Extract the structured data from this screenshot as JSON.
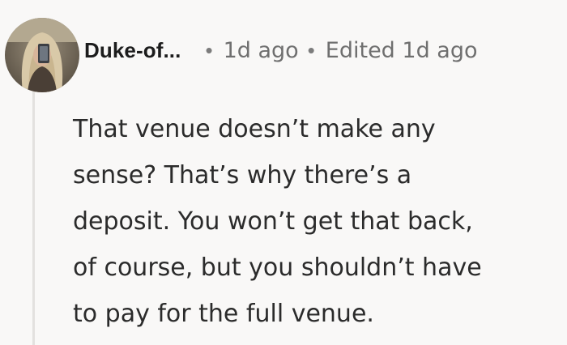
{
  "comment": {
    "author": "Duke-of...",
    "separator": "•",
    "timestamp": "1d ago",
    "edited_label": "Edited 1d ago",
    "body_lines": [
      "That venue doesn’t make any",
      "sense? That’s why there’s a",
      "deposit. You won’t get that back,",
      "of course, but you shouldn’t have",
      "to pay for the full venue."
    ]
  },
  "colors": {
    "background": "#f9f8f7",
    "thread_line": "#e3e1df",
    "author_text": "#1c1c1c",
    "meta_text": "#6f6f6f",
    "body_text": "#2b2b2b"
  }
}
